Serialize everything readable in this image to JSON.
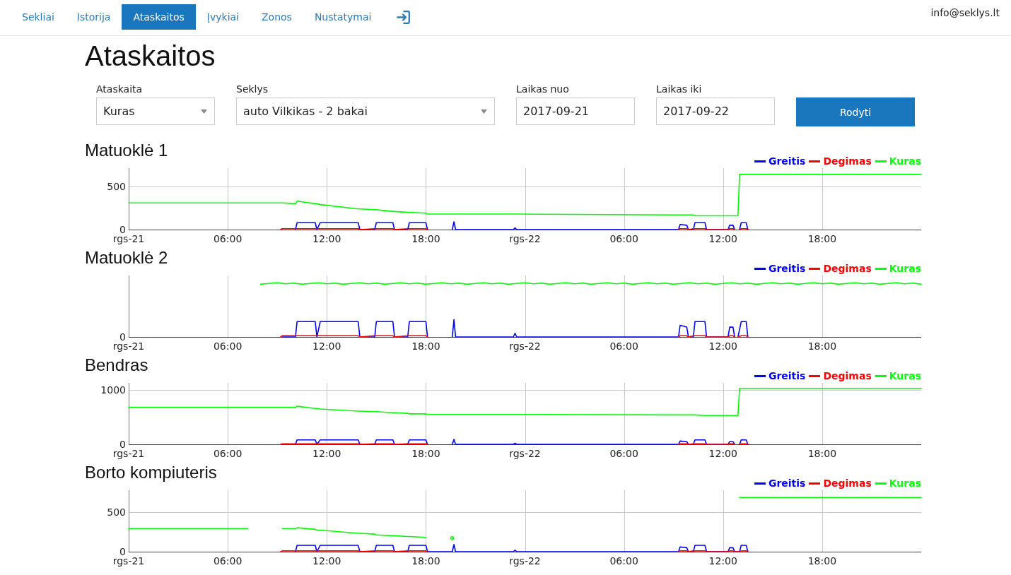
{
  "nav": {
    "tabs": [
      {
        "label": "Sekliai",
        "selected": false
      },
      {
        "label": "Istorija",
        "selected": false
      },
      {
        "label": "Ataskaitos",
        "selected": true
      },
      {
        "label": "Įvykiai",
        "selected": false
      },
      {
        "label": "Zonos",
        "selected": false
      },
      {
        "label": "Nustatymai",
        "selected": false
      }
    ],
    "user_email": "info@seklys.lt"
  },
  "page_title": "Ataskaitos",
  "filters": {
    "fields": [
      {
        "kind": "select",
        "label": "Ataskaita",
        "value": "Kuras"
      },
      {
        "kind": "select",
        "label": "Seklys",
        "value": "auto Vilkikas - 2 bakai"
      },
      {
        "kind": "date",
        "label": "Laikas nuo",
        "value": "2017-09-21"
      },
      {
        "kind": "date",
        "label": "Laikas iki",
        "value": "2017-09-22"
      }
    ],
    "submit": "Rodyti"
  },
  "sections": [
    {
      "title": "Matuoklė 1",
      "chart_data": {
        "type": "line",
        "grid": true,
        "legend": "upper right",
        "x": [
          "2017-09-21T00:00",
          "2017-09-21T07:12",
          "2017-09-21T07:18",
          "2017-09-21T08:00",
          "2017-09-21T09:12",
          "2017-09-21T09:18",
          "2017-09-21T10:06",
          "2017-09-21T10:12",
          "2017-09-21T11:18",
          "2017-09-21T11:24",
          "2017-09-21T11:36",
          "2017-09-21T13:54",
          "2017-09-21T14:00",
          "2017-09-21T14:54",
          "2017-09-21T15:00",
          "2017-09-21T16:00",
          "2017-09-21T16:06",
          "2017-09-21T16:54",
          "2017-09-21T17:00",
          "2017-09-21T18:00",
          "2017-09-21T18:06",
          "2017-09-21T18:18",
          "2017-09-21T19:24",
          "2017-09-21T19:36",
          "2017-09-21T19:42",
          "2017-09-21T19:48",
          "2017-09-21T23:18",
          "2017-09-21T23:24",
          "2017-09-21T23:30",
          "2017-09-22T09:18",
          "2017-09-22T09:24",
          "2017-09-22T09:48",
          "2017-09-22T09:54",
          "2017-09-22T10:12",
          "2017-09-22T10:18",
          "2017-09-22T10:54",
          "2017-09-22T11:00",
          "2017-09-22T12:18",
          "2017-09-22T12:24",
          "2017-09-22T12:36",
          "2017-09-22T12:42",
          "2017-09-22T12:54",
          "2017-09-22T13:00",
          "2017-09-22T13:06",
          "2017-09-22T13:24",
          "2017-09-22T13:30",
          "2017-09-23T00:00"
        ],
        "xlim": [
          "2017-09-21T00:00",
          "2017-09-23T00:00"
        ],
        "xticks": [
          {
            "value": "2017-09-21T00:00",
            "label": "rgs-21"
          },
          {
            "value": "2017-09-21T06:00",
            "label": "06:00"
          },
          {
            "value": "2017-09-21T12:00",
            "label": "12:00"
          },
          {
            "value": "2017-09-21T18:00",
            "label": "18:00"
          },
          {
            "value": "2017-09-22T00:00",
            "label": "rgs-22"
          },
          {
            "value": "2017-09-22T06:00",
            "label": "06:00"
          },
          {
            "value": "2017-09-22T12:00",
            "label": "12:00"
          },
          {
            "value": "2017-09-22T18:00",
            "label": "18:00"
          }
        ],
        "ylim": [
          0,
          713
        ],
        "yticks": [
          0,
          500
        ],
        "series": [
          {
            "name": "Greitis",
            "color": "#0000ff",
            "values": [
              null,
              null,
              null,
              null,
              null,
              null,
              0,
              80,
              80,
              0,
              80,
              80,
              0,
              0,
              80,
              80,
              0,
              0,
              80,
              80,
              0,
              null,
              null,
              0,
              90,
              0,
              0,
              20,
              0,
              0,
              60,
              50,
              0,
              0,
              80,
              80,
              0,
              0,
              50,
              50,
              0,
              null,
              0,
              80,
              80,
              0,
              null
            ]
          },
          {
            "name": "Degimas",
            "color": "#ff0000",
            "values": [
              null,
              null,
              null,
              null,
              0,
              10,
              10,
              10,
              10,
              10,
              10,
              10,
              0,
              10,
              10,
              10,
              0,
              10,
              10,
              10,
              0,
              null,
              null,
              null,
              null,
              null,
              null,
              null,
              null,
              0,
              10,
              10,
              0,
              10,
              10,
              10,
              0,
              0,
              10,
              10,
              0,
              null,
              0,
              10,
              10,
              0,
              null
            ]
          },
          {
            "name": "Kuras",
            "color": "#00ff00",
            "values": [
              310,
              310,
              310,
              310,
              310,
              310,
              300,
              330,
              300,
              300,
              290,
              240,
              240,
              230,
              230,
              210,
              210,
              200,
              200,
              190,
              180,
              180,
              180,
              180,
              180,
              180,
              180,
              180,
              180,
              170,
              170,
              170,
              170,
              170,
              160,
              160,
              160,
              160,
              160,
              160,
              160,
              160,
              640,
              640,
              640,
              640,
              640
            ]
          }
        ]
      }
    },
    {
      "title": "Matuoklė 2",
      "picture": {
        "legend": [
          {
            "name": "Greitis",
            "color": "#0000ff"
          },
          {
            "name": "Degimas",
            "color": "#ff0000"
          },
          {
            "name": "Kuras",
            "color": "#00ff00"
          }
        ],
        "y_label": "0",
        "x_labels": [
          "rgs-21",
          "06:00",
          "12:00",
          "18:00",
          "rgs-22",
          "06:00",
          "12:00",
          "18:00"
        ]
      }
    },
    {
      "title": "Bendras",
      "chart_data": {
        "type": "line",
        "grid": true,
        "legend": "upper right",
        "x": [
          "2017-09-21T00:00",
          "2017-09-21T07:12",
          "2017-09-21T07:18",
          "2017-09-21T08:00",
          "2017-09-21T09:12",
          "2017-09-21T09:18",
          "2017-09-21T10:06",
          "2017-09-21T10:12",
          "2017-09-21T11:18",
          "2017-09-21T11:24",
          "2017-09-21T11:36",
          "2017-09-21T13:54",
          "2017-09-21T14:00",
          "2017-09-21T14:54",
          "2017-09-21T15:00",
          "2017-09-21T16:00",
          "2017-09-21T16:06",
          "2017-09-21T16:54",
          "2017-09-21T17:00",
          "2017-09-21T18:00",
          "2017-09-21T18:06",
          "2017-09-21T18:18",
          "2017-09-21T19:24",
          "2017-09-21T19:36",
          "2017-09-21T19:42",
          "2017-09-21T19:48",
          "2017-09-21T23:18",
          "2017-09-21T23:24",
          "2017-09-21T23:30",
          "2017-09-22T09:18",
          "2017-09-22T09:24",
          "2017-09-22T09:48",
          "2017-09-22T09:54",
          "2017-09-22T10:12",
          "2017-09-22T10:18",
          "2017-09-22T10:54",
          "2017-09-22T11:00",
          "2017-09-22T12:18",
          "2017-09-22T12:24",
          "2017-09-22T12:36",
          "2017-09-22T12:42",
          "2017-09-22T12:54",
          "2017-09-22T13:00",
          "2017-09-22T13:06",
          "2017-09-22T13:24",
          "2017-09-22T13:30",
          "2017-09-23T00:00"
        ],
        "xlim": [
          "2017-09-21T00:00",
          "2017-09-23T00:00"
        ],
        "xticks": [
          {
            "value": "2017-09-21T00:00",
            "label": "rgs-21"
          },
          {
            "value": "2017-09-21T06:00",
            "label": "06:00"
          },
          {
            "value": "2017-09-21T12:00",
            "label": "12:00"
          },
          {
            "value": "2017-09-21T18:00",
            "label": "18:00"
          },
          {
            "value": "2017-09-22T00:00",
            "label": "rgs-22"
          },
          {
            "value": "2017-09-22T06:00",
            "label": "06:00"
          },
          {
            "value": "2017-09-22T12:00",
            "label": "12:00"
          },
          {
            "value": "2017-09-22T18:00",
            "label": "18:00"
          }
        ],
        "ylim": [
          0,
          1130
        ],
        "yticks": [
          0,
          1000
        ],
        "series": [
          {
            "name": "Greitis",
            "color": "#0000ff",
            "values": [
              null,
              null,
              null,
              null,
              null,
              null,
              0,
              80,
              80,
              0,
              80,
              80,
              0,
              0,
              80,
              80,
              0,
              0,
              80,
              80,
              0,
              null,
              null,
              0,
              90,
              0,
              0,
              20,
              0,
              0,
              60,
              50,
              0,
              0,
              80,
              80,
              0,
              0,
              50,
              50,
              0,
              null,
              0,
              80,
              80,
              0,
              null
            ]
          },
          {
            "name": "Degimas",
            "color": "#ff0000",
            "values": [
              null,
              null,
              null,
              null,
              0,
              10,
              10,
              10,
              10,
              10,
              10,
              10,
              0,
              10,
              10,
              10,
              0,
              10,
              10,
              10,
              0,
              null,
              null,
              null,
              null,
              null,
              null,
              null,
              null,
              0,
              10,
              10,
              0,
              10,
              10,
              10,
              0,
              0,
              10,
              10,
              0,
              null,
              0,
              10,
              10,
              0,
              null
            ]
          },
          {
            "name": "Kuras",
            "color": "#00ff00",
            "values": [
              680,
              680,
              680,
              680,
              680,
              680,
              680,
              700,
              660,
              660,
              650,
              610,
              610,
              600,
              600,
              580,
              580,
              570,
              560,
              560,
              550,
              550,
              550,
              550,
              550,
              550,
              550,
              550,
              550,
              540,
              540,
              540,
              540,
              540,
              540,
              530,
              530,
              530,
              530,
              530,
              530,
              530,
              1030,
              1030,
              1030,
              1030,
              1030
            ]
          }
        ]
      }
    },
    {
      "title": "Borto kompiuteris",
      "chart_data": {
        "type": "line",
        "grid": true,
        "legend": "upper right",
        "x": [
          "2017-09-21T00:00",
          "2017-09-21T07:12",
          "2017-09-21T09:12",
          "2017-09-21T09:18",
          "2017-09-21T10:06",
          "2017-09-21T10:12",
          "2017-09-21T11:18",
          "2017-09-21T11:24",
          "2017-09-21T11:36",
          "2017-09-21T13:54",
          "2017-09-21T14:00",
          "2017-09-21T14:54",
          "2017-09-21T15:00",
          "2017-09-21T16:00",
          "2017-09-21T16:06",
          "2017-09-21T16:54",
          "2017-09-21T17:00",
          "2017-09-21T18:00",
          "2017-09-21T18:06",
          "2017-09-21T19:36",
          "2017-09-21T19:42",
          "2017-09-21T19:48",
          "2017-09-21T23:18",
          "2017-09-21T23:24",
          "2017-09-21T23:30",
          "2017-09-22T09:18",
          "2017-09-22T09:24",
          "2017-09-22T09:48",
          "2017-09-22T09:54",
          "2017-09-22T10:12",
          "2017-09-22T10:18",
          "2017-09-22T10:54",
          "2017-09-22T11:00",
          "2017-09-22T12:18",
          "2017-09-22T12:24",
          "2017-09-22T12:36",
          "2017-09-22T12:42",
          "2017-09-22T13:00",
          "2017-09-22T13:06",
          "2017-09-22T13:24",
          "2017-09-22T13:30",
          "2017-09-23T00:00"
        ],
        "xlim": [
          "2017-09-21T00:00",
          "2017-09-23T00:00"
        ],
        "xticks": [
          {
            "value": "2017-09-21T00:00",
            "label": "rgs-21"
          },
          {
            "value": "2017-09-21T06:00",
            "label": "06:00"
          },
          {
            "value": "2017-09-21T12:00",
            "label": "12:00"
          },
          {
            "value": "2017-09-21T18:00",
            "label": "18:00"
          },
          {
            "value": "2017-09-22T00:00",
            "label": "rgs-22"
          },
          {
            "value": "2017-09-22T06:00",
            "label": "06:00"
          },
          {
            "value": "2017-09-22T12:00",
            "label": "12:00"
          },
          {
            "value": "2017-09-22T18:00",
            "label": "18:00"
          }
        ],
        "ylim": [
          0,
          770
        ],
        "yticks": [
          0,
          500
        ],
        "series": [
          {
            "name": "Greitis",
            "color": "#0000ff",
            "values": [
              null,
              null,
              null,
              null,
              0,
              80,
              80,
              0,
              80,
              80,
              0,
              0,
              80,
              80,
              0,
              0,
              80,
              80,
              0,
              0,
              90,
              0,
              0,
              20,
              0,
              0,
              60,
              50,
              0,
              0,
              80,
              80,
              0,
              0,
              50,
              50,
              0,
              0,
              80,
              80,
              0,
              null
            ]
          },
          {
            "name": "Degimas",
            "color": "#ff0000",
            "values": [
              null,
              null,
              0,
              10,
              10,
              10,
              10,
              10,
              10,
              10,
              0,
              10,
              10,
              10,
              0,
              10,
              10,
              10,
              0,
              null,
              null,
              null,
              null,
              null,
              null,
              0,
              10,
              10,
              0,
              10,
              10,
              10,
              0,
              0,
              10,
              10,
              0,
              0,
              10,
              10,
              0,
              null
            ]
          },
          {
            "name": "Kuras",
            "color": "#00ff00",
            "values": [
              290,
              290,
              null,
              290,
              290,
              300,
              280,
              270,
              270,
              230,
              230,
              220,
              210,
              200,
              200,
              190,
              190,
              180,
              null,
              170,
              null,
              null,
              null,
              null,
              null,
              null,
              null,
              null,
              null,
              null,
              null,
              null,
              null,
              null,
              null,
              null,
              null,
              680,
              680,
              680,
              680,
              680
            ]
          }
        ]
      }
    }
  ]
}
